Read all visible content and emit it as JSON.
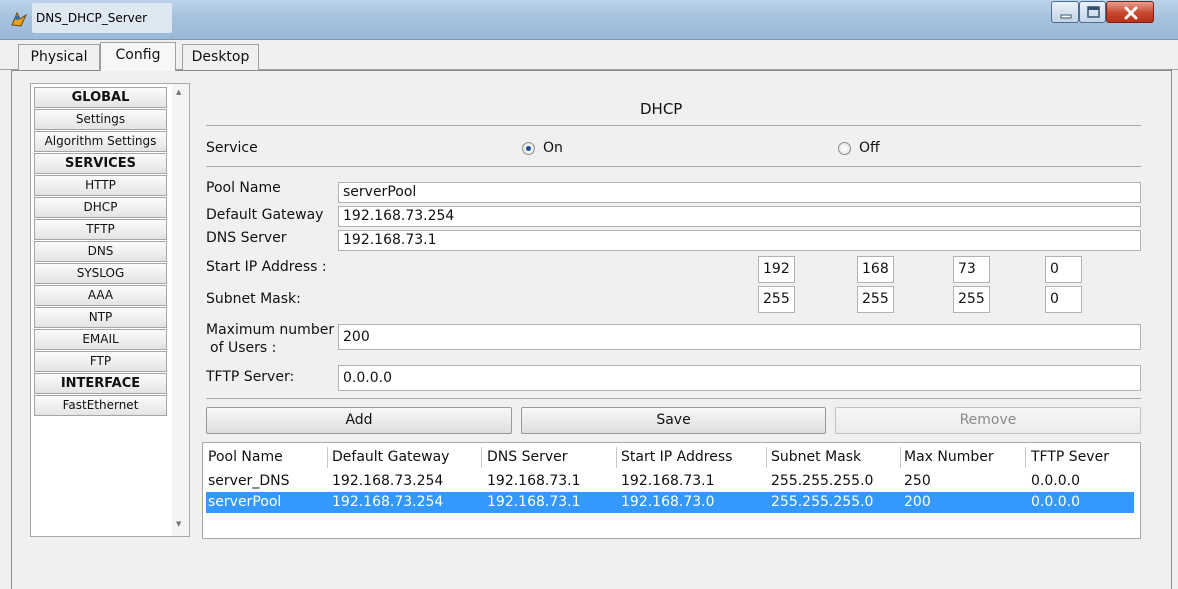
{
  "window": {
    "title": "DNS_DHCP_Server",
    "app_icon": "packet-tracer-icon",
    "minimize_icon": "minimize-icon",
    "maximize_icon": "maximize-icon",
    "close_icon": "close-icon"
  },
  "tabs": [
    {
      "label": "Physical",
      "selected": false
    },
    {
      "label": "Config",
      "selected": true
    },
    {
      "label": "Desktop",
      "selected": false
    }
  ],
  "sidebar": {
    "items": [
      {
        "label": "GLOBAL",
        "header": true
      },
      {
        "label": "Settings"
      },
      {
        "label": "Algorithm Settings"
      },
      {
        "label": "SERVICES",
        "header": true
      },
      {
        "label": "HTTP"
      },
      {
        "label": "DHCP"
      },
      {
        "label": "TFTP"
      },
      {
        "label": "DNS"
      },
      {
        "label": "SYSLOG"
      },
      {
        "label": "AAA"
      },
      {
        "label": "NTP"
      },
      {
        "label": "EMAIL"
      },
      {
        "label": "FTP"
      },
      {
        "label": "INTERFACE",
        "header": true
      },
      {
        "label": "FastEthernet"
      }
    ]
  },
  "dhcp": {
    "title": "DHCP",
    "service_label": "Service",
    "on_label": "On",
    "off_label": "Off",
    "service_state": "On",
    "pool_name_label": "Pool Name",
    "pool_name": "serverPool",
    "default_gateway_label": "Default Gateway",
    "default_gateway": "192.168.73.254",
    "dns_server_label": "DNS Server",
    "dns_server": "192.168.73.1",
    "start_ip_label": "Start IP Address :",
    "start_ip": [
      "192",
      "168",
      "73",
      "0"
    ],
    "subnet_mask_label": "Subnet Mask:",
    "subnet_mask": [
      "255",
      "255",
      "255",
      "0"
    ],
    "max_users_label_1": "Maximum number",
    "max_users_label_2": "of Users :",
    "max_users": "200",
    "tftp_label": "TFTP Server:",
    "tftp_server": "0.0.0.0",
    "add_label": "Add",
    "save_label": "Save",
    "remove_label": "Remove"
  },
  "table": {
    "columns": [
      "Pool Name",
      "Default Gateway",
      "DNS Server",
      "Start IP Address",
      "Subnet Mask",
      "Max Number",
      "TFTP Sever"
    ],
    "rows": [
      {
        "cells": [
          "server_DNS",
          "192.168.73.254",
          "192.168.73.1",
          "192.168.73.1",
          "255.255.255.0",
          "250",
          "0.0.0.0"
        ],
        "selected": false
      },
      {
        "cells": [
          "serverPool",
          "192.168.73.254",
          "192.168.73.1",
          "192.168.73.0",
          "255.255.255.0",
          "200",
          "0.0.0.0"
        ],
        "selected": true
      }
    ]
  },
  "colors": {
    "selection": "#3399ff",
    "close_button": "#c6472e"
  }
}
